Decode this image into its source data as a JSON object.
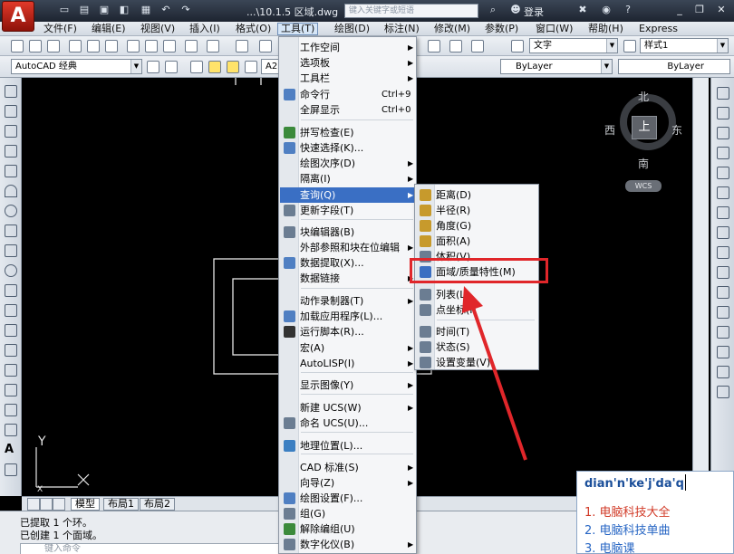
{
  "title_bar": {
    "file_name": "...\\10.1.5 区域.dwg",
    "search_placeholder": "键入关键字或短语",
    "login_label": "登录",
    "help_label": "?"
  },
  "menubar": {
    "items": [
      "文件(F)",
      "编辑(E)",
      "视图(V)",
      "插入(I)",
      "格式(O)",
      "工具(T)",
      "绘图(D)",
      "标注(N)",
      "修改(M)",
      "参数(P)",
      "窗口(W)",
      "帮助(H)",
      "Express"
    ]
  },
  "toolbar": {
    "text_style": "文字",
    "dim_style": "样式1",
    "workspace": "AutoCAD 经典",
    "layer": "A2",
    "color": "ByLayer",
    "linetype": "ByLayer"
  },
  "viewcube": {
    "north": "北",
    "south": "南",
    "east": "东",
    "west": "西",
    "face": "上",
    "wcs": "WCS"
  },
  "ucs": {
    "x": "X",
    "y": "Y"
  },
  "tools_menu": {
    "items": [
      {
        "label": "工作空间",
        "shortcut": "",
        "sub": true
      },
      {
        "label": "选项板",
        "shortcut": "",
        "sub": true
      },
      {
        "label": "工具栏",
        "shortcut": "",
        "sub": true
      },
      {
        "label": "命令行",
        "shortcut": "Ctrl+9",
        "sub": false
      },
      {
        "label": "全屏显示",
        "shortcut": "Ctrl+0",
        "sub": false
      },
      {
        "label": "拼写检查(E)",
        "shortcut": "",
        "sub": false
      },
      {
        "label": "快速选择(K)...",
        "shortcut": "",
        "sub": false
      },
      {
        "label": "绘图次序(D)",
        "shortcut": "",
        "sub": true
      },
      {
        "label": "隔离(I)",
        "shortcut": "",
        "sub": true
      },
      {
        "label": "查询(Q)",
        "shortcut": "",
        "sub": true
      },
      {
        "label": "更新字段(T)",
        "shortcut": "",
        "sub": false
      },
      {
        "label": "块编辑器(B)",
        "shortcut": "",
        "sub": false
      },
      {
        "label": "外部参照和块在位编辑",
        "shortcut": "",
        "sub": true
      },
      {
        "label": "数据提取(X)...",
        "shortcut": "",
        "sub": false
      },
      {
        "label": "数据链接",
        "shortcut": "",
        "sub": true
      },
      {
        "label": "动作录制器(T)",
        "shortcut": "",
        "sub": true
      },
      {
        "label": "加载应用程序(L)...",
        "shortcut": "",
        "sub": false
      },
      {
        "label": "运行脚本(R)...",
        "shortcut": "",
        "sub": false
      },
      {
        "label": "宏(A)",
        "shortcut": "",
        "sub": true
      },
      {
        "label": "AutoLISP(I)",
        "shortcut": "",
        "sub": true
      },
      {
        "label": "显示图像(Y)",
        "shortcut": "",
        "sub": true
      },
      {
        "label": "新建 UCS(W)",
        "shortcut": "",
        "sub": true
      },
      {
        "label": "命名 UCS(U)...",
        "shortcut": "",
        "sub": false
      },
      {
        "label": "地理位置(L)...",
        "shortcut": "",
        "sub": false
      },
      {
        "label": "CAD 标准(S)",
        "shortcut": "",
        "sub": true
      },
      {
        "label": "向导(Z)",
        "shortcut": "",
        "sub": true
      },
      {
        "label": "绘图设置(F)...",
        "shortcut": "",
        "sub": false
      },
      {
        "label": "组(G)",
        "shortcut": "",
        "sub": false
      },
      {
        "label": "解除编组(U)",
        "shortcut": "",
        "sub": false
      },
      {
        "label": "数字化仪(B)",
        "shortcut": "",
        "sub": true
      }
    ]
  },
  "query_submenu": {
    "items": [
      "距离(D)",
      "半径(R)",
      "角度(G)",
      "面积(A)",
      "体积(V)",
      "面域/质量特性(M)",
      "列表(L)",
      "点坐标(I)",
      "时间(T)",
      "状态(S)",
      "设置变量(V)"
    ]
  },
  "layout_tabs": [
    "模型",
    "布局1",
    "布局2"
  ],
  "command": {
    "line1": "已提取 1 个环。",
    "line2": "已创建 1 个面域。",
    "placeholder": "键入命令"
  },
  "ime": {
    "pinyin": "dian'n'ke'j'da'q",
    "candidates": [
      "1. 电脑科技大全",
      "2. 电脑科技单曲",
      "3. 电脑课"
    ]
  },
  "colors": {
    "highlight": "#3a6fc4",
    "annotation_red": "#e0262a",
    "canvas": "#000000"
  }
}
